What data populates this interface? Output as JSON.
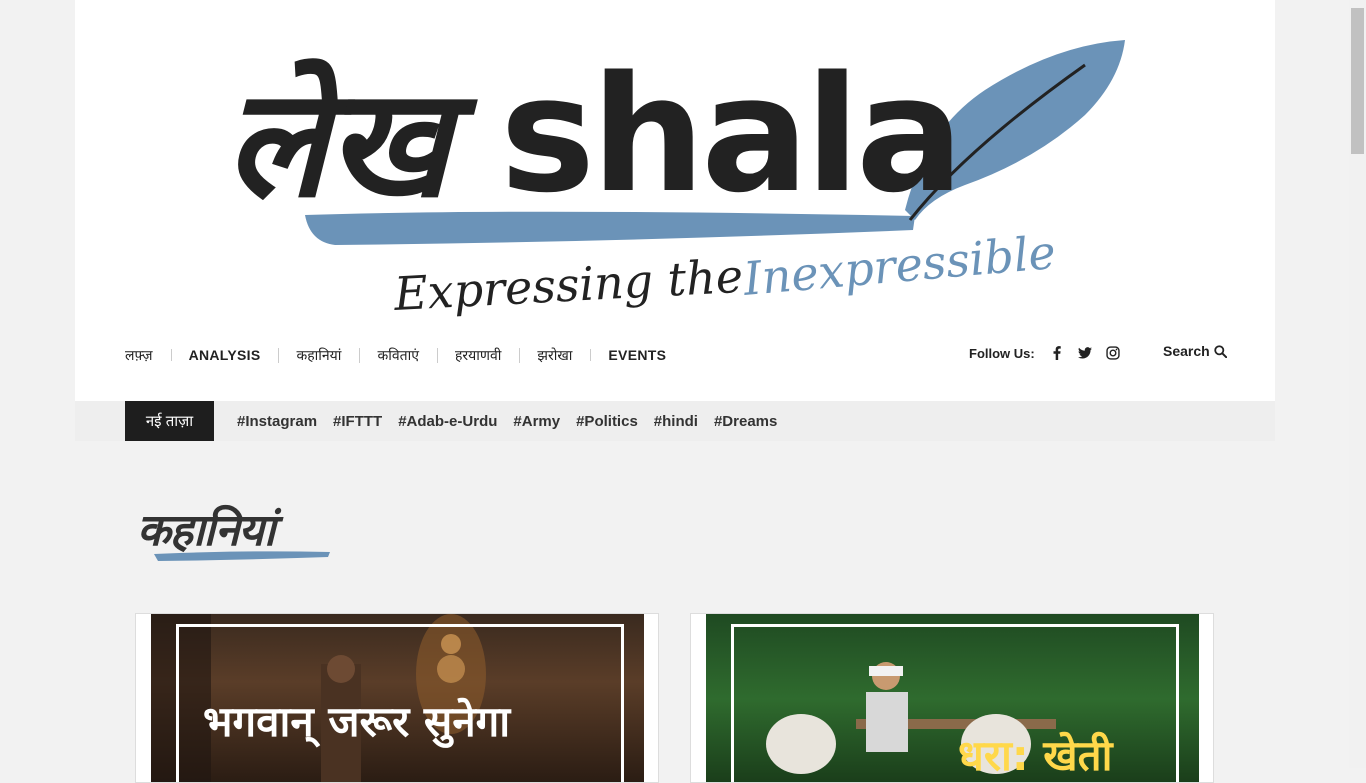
{
  "logo": {
    "text_hindi": "लेख",
    "text_latin": "shala",
    "tagline_part1": "Expressing the",
    "tagline_part2": "Inexpressible"
  },
  "nav": {
    "items": [
      {
        "label": "लफ़्ज़"
      },
      {
        "label": "ANALYSIS"
      },
      {
        "label": "कहानियां"
      },
      {
        "label": "कविताएं"
      },
      {
        "label": "हरयाणवी"
      },
      {
        "label": "झरोखा"
      },
      {
        "label": "EVENTS"
      }
    ]
  },
  "follow": {
    "label": "Follow Us:",
    "icons": [
      "facebook-icon",
      "twitter-icon",
      "instagram-icon"
    ]
  },
  "search": {
    "label": "Search"
  },
  "trending": {
    "label": "नई ताज़ा",
    "tags": [
      "#Instagram",
      "#IFTTT",
      "#Adab-e-Urdu",
      "#Army",
      "#Politics",
      "#hindi",
      "#Dreams"
    ]
  },
  "section": {
    "title": "कहानियां"
  },
  "cards": [
    {
      "caption": "भगवान् जरूर सुनेगा"
    },
    {
      "caption": "धरा: खेती"
    }
  ],
  "colors": {
    "accent_blue": "#6b93b8",
    "dark": "#1e1e1e",
    "background": "#f2f2f2"
  }
}
